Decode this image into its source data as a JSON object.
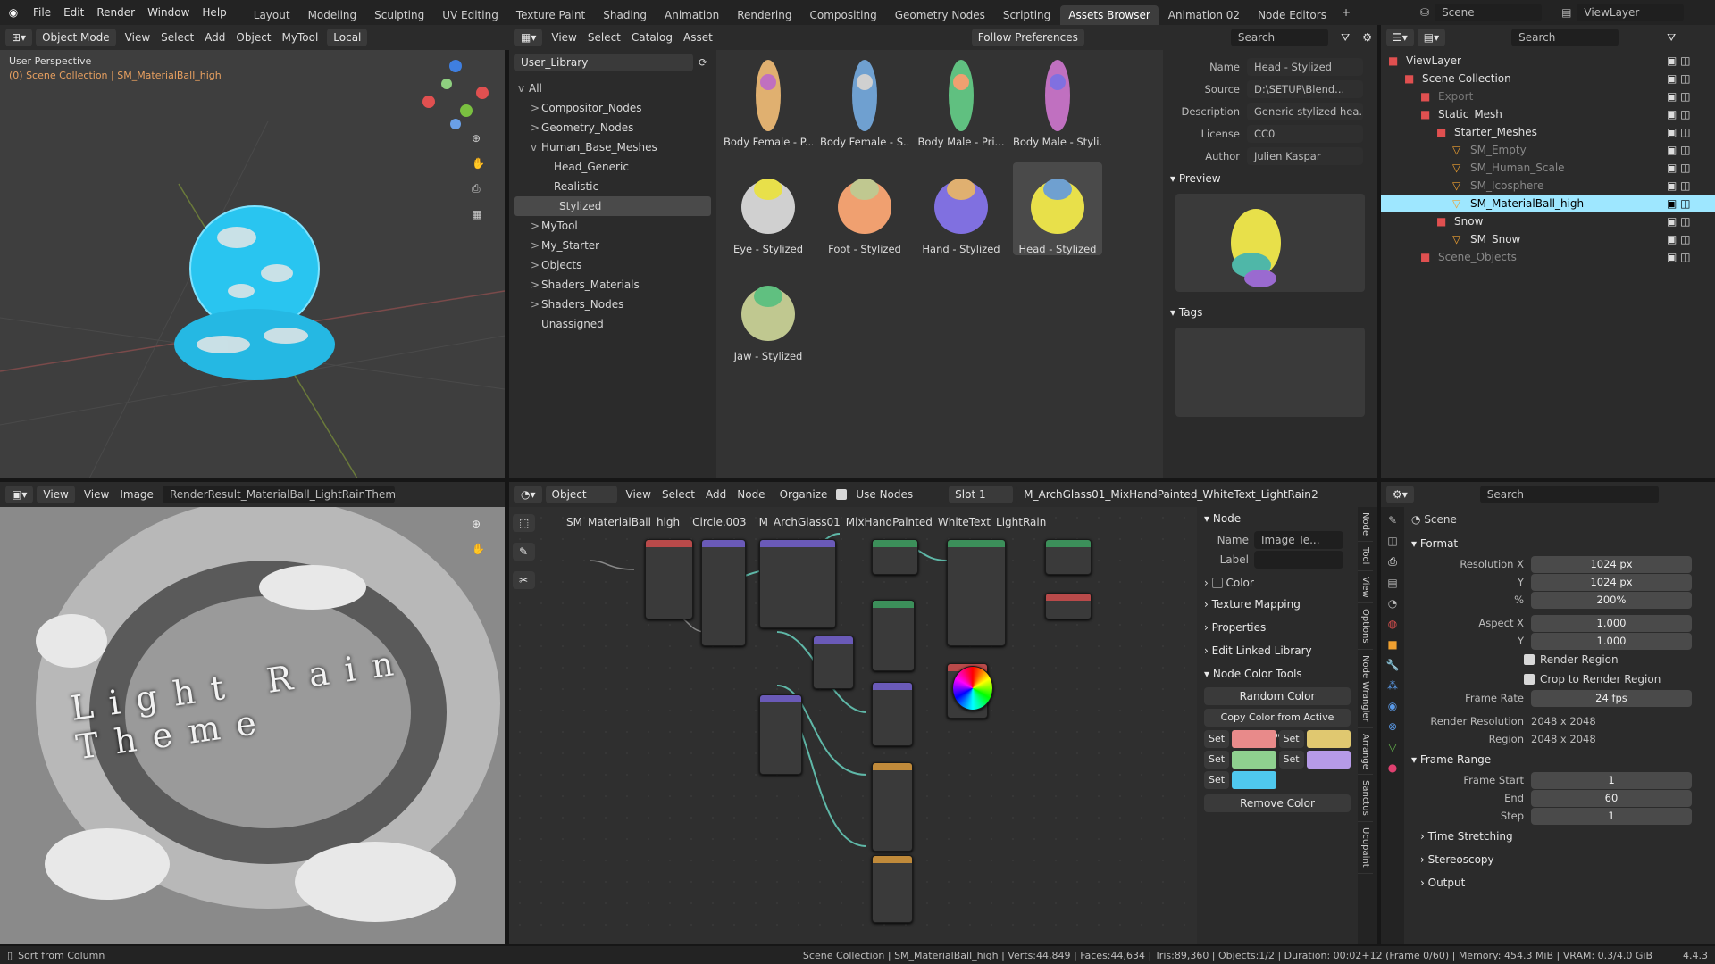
{
  "menu": [
    "File",
    "Edit",
    "Render",
    "Window",
    "Help"
  ],
  "workspaces": [
    "Layout",
    "Modeling",
    "Sculpting",
    "UV Editing",
    "Texture Paint",
    "Shading",
    "Animation",
    "Rendering",
    "Compositing",
    "Geometry Nodes",
    "Scripting",
    "Assets Browser",
    "Animation 02",
    "Node Editors"
  ],
  "active_workspace": "Assets Browser",
  "scene": "Scene",
  "view_layer": "ViewLayer",
  "viewport": {
    "mode": "Object Mode",
    "menus": [
      "View",
      "Select",
      "Add",
      "Object",
      "MyTool"
    ],
    "orientation": "Local",
    "overlay_title": "User Perspective",
    "overlay_sub": "(0) Scene Collection | SM_MaterialBall_high"
  },
  "asset_browser": {
    "menus": [
      "View",
      "Select",
      "Catalog",
      "Asset"
    ],
    "library": "User_Library",
    "import": "Follow Preferences",
    "search_placeholder": "Search",
    "tree": [
      {
        "label": "All",
        "lvl": 0,
        "exp": "v"
      },
      {
        "label": "Compositor_Nodes",
        "lvl": 1,
        "exp": ">"
      },
      {
        "label": "Geometry_Nodes",
        "lvl": 1,
        "exp": ">"
      },
      {
        "label": "Human_Base_Meshes",
        "lvl": 1,
        "exp": "v"
      },
      {
        "label": "Head_Generic",
        "lvl": 2,
        "exp": ""
      },
      {
        "label": "Realistic",
        "lvl": 2,
        "exp": ""
      },
      {
        "label": "Stylized",
        "lvl": 2,
        "exp": "",
        "sel": true
      },
      {
        "label": "MyTool",
        "lvl": 1,
        "exp": ">"
      },
      {
        "label": "My_Starter",
        "lvl": 1,
        "exp": ">"
      },
      {
        "label": "Objects",
        "lvl": 1,
        "exp": ">"
      },
      {
        "label": "Shaders_Materials",
        "lvl": 1,
        "exp": ">"
      },
      {
        "label": "Shaders_Nodes",
        "lvl": 1,
        "exp": ">"
      },
      {
        "label": "Unassigned",
        "lvl": 1,
        "exp": ""
      }
    ],
    "assets": [
      "Body Female - P...",
      "Body Female - S...",
      "Body Male - Pri...",
      "Body Male - Styli...",
      "Eye - Stylized",
      "Foot - Stylized",
      "Hand - Stylized",
      "Head - Stylized",
      "Jaw - Stylized"
    ],
    "selected_asset": "Head - Stylized",
    "meta": {
      "name_label": "Name",
      "name": "Head - Stylized",
      "source_label": "Source",
      "source": "D:\\SETUP\\Blend...",
      "desc_label": "Description",
      "desc": "Generic stylized hea...",
      "license_label": "License",
      "license": "CC0",
      "author_label": "Author",
      "author": "Julien Kaspar"
    },
    "preview_label": "Preview",
    "tags_label": "Tags"
  },
  "outliner": {
    "search": "Search",
    "items": [
      {
        "label": "ViewLayer",
        "lvl": 0,
        "color": "#e0e0e0"
      },
      {
        "label": "Scene Collection",
        "lvl": 1,
        "color": "#e0e0e0"
      },
      {
        "label": "Export",
        "lvl": 2,
        "color": "#777"
      },
      {
        "label": "Static_Mesh",
        "lvl": 2,
        "color": "#e0e0e0"
      },
      {
        "label": "Starter_Meshes",
        "lvl": 3,
        "color": "#e0e0e0"
      },
      {
        "label": "SM_Empty",
        "lvl": 4,
        "color": "#888"
      },
      {
        "label": "SM_Human_Scale",
        "lvl": 4,
        "color": "#888"
      },
      {
        "label": "SM_Icosphere",
        "lvl": 4,
        "color": "#888"
      },
      {
        "label": "SM_MaterialBall_high",
        "lvl": 4,
        "color": "#ffffff",
        "sel": true
      },
      {
        "label": "Snow",
        "lvl": 3,
        "color": "#e0e0e0"
      },
      {
        "label": "SM_Snow",
        "lvl": 4,
        "color": "#e0e0e0"
      },
      {
        "label": "Scene_Objects",
        "lvl": 2,
        "color": "#888"
      }
    ]
  },
  "image_editor": {
    "view": "View",
    "menus": [
      "View",
      "Image"
    ],
    "image": "RenderResult_MaterialBall_LightRainTheme.tif",
    "text": "Light Rain Theme"
  },
  "node_editor": {
    "type": "Object",
    "menus": [
      "View",
      "Select",
      "Add",
      "Node"
    ],
    "organize": "Organize",
    "use_nodes": "Use Nodes",
    "slot": "Slot 1",
    "material": "M_ArchGlass01_MixHandPainted_WhiteText_LightRain",
    "users": "2",
    "breadcrumb": [
      "SM_MaterialBall_high",
      "Circle.003",
      "M_ArchGlass01_MixHandPainted_WhiteText_LightRain"
    ],
    "sidebar": {
      "node_label": "Node",
      "name_label": "Name",
      "name": "Image Te...",
      "label_label": "Label",
      "color_label": "Color",
      "sections": [
        "Texture Mapping",
        "Properties",
        "Edit Linked Library"
      ],
      "color_tools": "Node Color Tools",
      "random": "Random Color",
      "copy": "Copy Color from Active Node",
      "set": "Set",
      "remove": "Remove Color",
      "swatches": [
        "#e88a8a",
        "#e0c870",
        "#8fd08f",
        "#b69ae8",
        "#4fc8ee"
      ]
    },
    "side_tabs": [
      "Node",
      "Tool",
      "View",
      "Options",
      "Node Wrangler",
      "Arrange",
      "Sanctus",
      "Ucupaint"
    ]
  },
  "properties": {
    "search": "Search",
    "scene": "Scene",
    "format": "Format",
    "res_x_label": "Resolution X",
    "res_x": "1024 px",
    "y_label": "Y",
    "res_y": "1024 px",
    "pct_label": "%",
    "pct": "200%",
    "aspect_x_label": "Aspect X",
    "aspect_x": "1.000",
    "aspect_y": "1.000",
    "render_region": "Render Region",
    "crop": "Crop to Render Region",
    "fps_label": "Frame Rate",
    "fps": "24 fps",
    "render_res_label": "Render Resolution",
    "render_res": "2048 x 2048",
    "region_label": "Region",
    "region": "2048 x 2048",
    "frame_range": "Frame Range",
    "start_label": "Frame Start",
    "start": "1",
    "end_label": "End",
    "end": "60",
    "step_label": "Step",
    "step": "1",
    "time_stretch": "Time Stretching",
    "stereo": "Stereoscopy",
    "output": "Output"
  },
  "status": {
    "left": "Sort from Column",
    "right": "Scene Collection | SM_MaterialBall_high | Verts:44,849 | Faces:44,634 | Tris:89,360 | Objects:1/2 | Duration: 00:02+12 (Frame 0/60) | Memory: 454.3 MiB | VRAM: 0.3/4.0 GiB",
    "version": "4.4.3"
  },
  "colors": {
    "accent": "#4772b3",
    "selection": "#9ee7ff",
    "wire": "#29c5f0"
  }
}
